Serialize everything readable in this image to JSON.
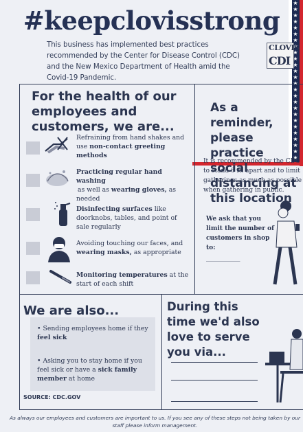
{
  "title": "#keepclovisstrong",
  "intro": "This business has implemented best practices recommended by the Center for Disease Control (CDC) and the New Mexico Department of Health amid the Covid-19 Pandemic.",
  "logo": {
    "line1": "CLOVIS",
    "line2": "CDI"
  },
  "health": {
    "heading": "For the health of our employees and customers, we are...",
    "items": [
      {
        "pre": "Refraining from hand shakes and use ",
        "bold": "non-contact greeting methods",
        "post": ""
      },
      {
        "pre": "",
        "bold": "Practicing regular hand washing",
        "mid": " as well as ",
        "bold2": "wearing gloves,",
        "post": " as needed"
      },
      {
        "pre": "",
        "bold": "Disinfecting surfaces",
        "post": " like doorknobs, tables, and point of sale regularly"
      },
      {
        "pre": "Avoiding touching our faces, and ",
        "bold": "wearing masks,",
        "post": " as appropriate"
      },
      {
        "pre": "",
        "bold": "Monitoring temperatures",
        "post": " at the start of each shift"
      }
    ]
  },
  "reminder": {
    "heading": "As a reminder, please practice social distancing at this location",
    "body": "It is recommended by the CDC to stand 6 ft. apart and to limit gatherings as much as possible when gathering in public.",
    "ask": "We ask that you limit the number of customers in shop to:",
    "blank": "___________"
  },
  "also": {
    "heading": "We are also...",
    "items": [
      {
        "pre": "Sending employees home if they ",
        "bold": "feel sick"
      },
      {
        "pre": "Asking you to stay home if you feel sick or have a ",
        "bold": "sick family member",
        "post": " at home"
      }
    ],
    "source": "SOURCE: CDC.GOV"
  },
  "serve": {
    "heading": "During this time we'd also love to serve you via..."
  },
  "footer": "As always our employees and customers are important to us. If you see any of these steps not being taken by our staff please inform management."
}
